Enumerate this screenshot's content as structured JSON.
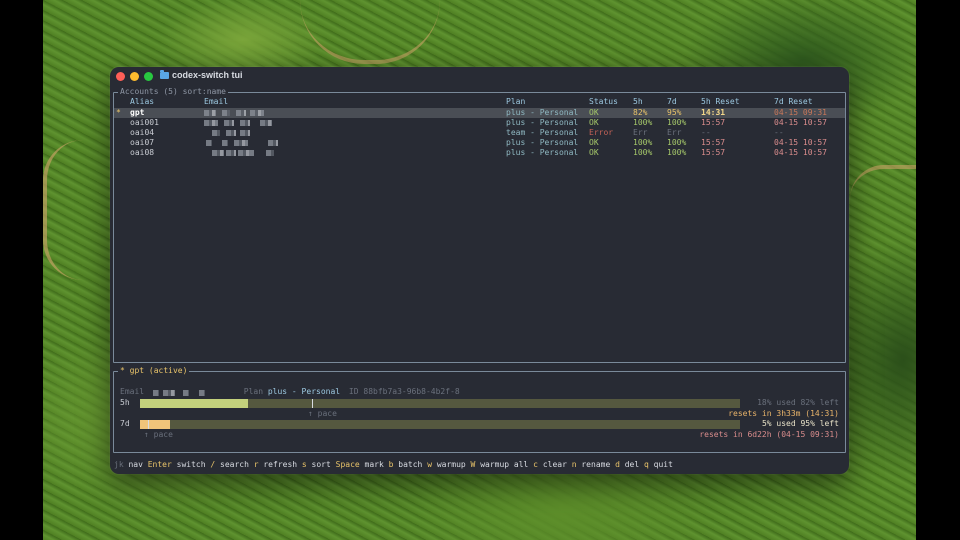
{
  "window": {
    "title": "codex-switch tui"
  },
  "accounts": {
    "legend": "Accounts (5) sort:name",
    "columns": {
      "alias": "Alias",
      "email": "Email",
      "plan": "Plan",
      "status": "Status",
      "h5": "5h",
      "d7": "7d",
      "h5_reset": "5h Reset",
      "d7_reset": "7d Reset"
    },
    "rows": [
      {
        "mark": "*",
        "alias": "gpt",
        "plan": "plus - Personal",
        "status": "OK",
        "h5": "82%",
        "d7": "95%",
        "h5_reset": "14:31",
        "d7_reset": "04-15 09:31"
      },
      {
        "mark": "",
        "alias": "oai001",
        "plan": "plus - Personal",
        "status": "OK",
        "h5": "100%",
        "d7": "100%",
        "h5_reset": "15:57",
        "d7_reset": "04-15 10:57"
      },
      {
        "mark": "",
        "alias": "oai04",
        "plan": "team - Personal",
        "status": "Error",
        "h5": "Err",
        "d7": "Err",
        "h5_reset": "--",
        "d7_reset": "--"
      },
      {
        "mark": "",
        "alias": "oai07",
        "plan": "plus - Personal",
        "status": "OK",
        "h5": "100%",
        "d7": "100%",
        "h5_reset": "15:57",
        "d7_reset": "04-15 10:57"
      },
      {
        "mark": "",
        "alias": "oai08",
        "plan": "plus - Personal",
        "status": "OK",
        "h5": "100%",
        "d7": "100%",
        "h5_reset": "15:57",
        "d7_reset": "04-15 10:57"
      }
    ]
  },
  "detail": {
    "legend": "* gpt (active)",
    "email_label": "Email",
    "plan_label": "Plan",
    "plan_value": "plus - Personal",
    "id_text": "ID 88bfb7a3-96b8-4b2f-8",
    "h5": {
      "label": "5h",
      "used_fraction": 0.18,
      "usage_text": "18% used  82% left",
      "pace_label": "↑ pace",
      "reset_text": "resets in 3h33m (14:31)"
    },
    "d7": {
      "label": "7d",
      "used_fraction": 0.05,
      "usage_text": "5% used  95% left",
      "pace_label": "↑ pace",
      "reset_text": "resets in 6d22h (04-15 09:31)"
    }
  },
  "footer": [
    {
      "key": "jk",
      "desc": "nav",
      "dim": true
    },
    {
      "key": "Enter",
      "desc": "switch"
    },
    {
      "key": "/",
      "desc": "search"
    },
    {
      "key": "r",
      "desc": "refresh"
    },
    {
      "key": "s",
      "desc": "sort"
    },
    {
      "key": "Space",
      "desc": "mark"
    },
    {
      "key": "b",
      "desc": "batch"
    },
    {
      "key": "w",
      "desc": "warmup"
    },
    {
      "key": "W",
      "desc": "warmup all"
    },
    {
      "key": "c",
      "desc": "clear"
    },
    {
      "key": "n",
      "desc": "rename"
    },
    {
      "key": "d",
      "desc": "del"
    },
    {
      "key": "q",
      "desc": "quit"
    }
  ],
  "colors": {
    "ok": "#a6c86a",
    "error": "#c46257",
    "h5_bar": "#c3d17c",
    "d7_bar": "#f0c47a",
    "bar_track": "#55583f",
    "key_hint": "#e9c46a"
  }
}
